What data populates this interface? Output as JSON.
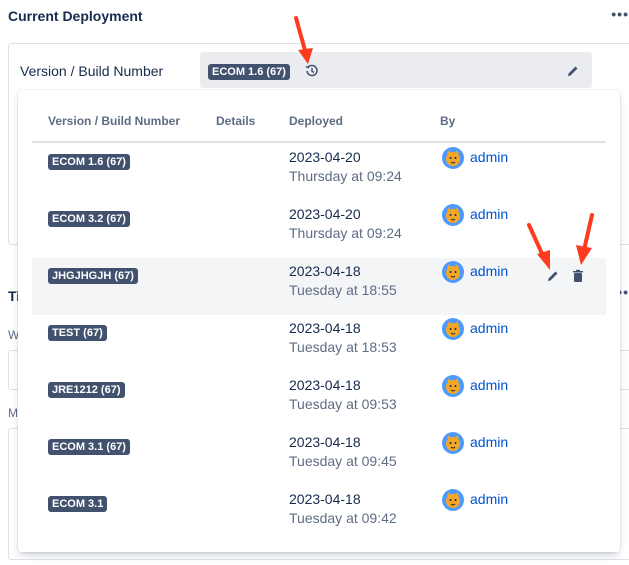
{
  "section": {
    "title": "Current Deployment",
    "more_label": "•••",
    "field_label": "Version / Build Number",
    "current_version": "ECOM 1.6 (67)"
  },
  "background": {
    "frag1": "Ti",
    "frag2": "W",
    "frag3": "M"
  },
  "history": {
    "columns": {
      "version": "Version / Build Number",
      "details": "Details",
      "deployed": "Deployed",
      "by": "By"
    },
    "rows": [
      {
        "version": "ECOM 1.6 (67)",
        "date": "2023-04-20",
        "time": "Thursday at 09:24",
        "user": "admin"
      },
      {
        "version": "ECOM 3.2 (67)",
        "date": "2023-04-20",
        "time": "Thursday at 09:24",
        "user": "admin"
      },
      {
        "version": "JHGJHGJH (67)",
        "date": "2023-04-18",
        "time": "Tuesday at 18:55",
        "user": "admin"
      },
      {
        "version": "TEST (67)",
        "date": "2023-04-18",
        "time": "Tuesday at 18:53",
        "user": "admin"
      },
      {
        "version": "JRE1212 (67)",
        "date": "2023-04-18",
        "time": "Tuesday at 09:53",
        "user": "admin"
      },
      {
        "version": "ECOM 3.1 (67)",
        "date": "2023-04-18",
        "time": "Tuesday at 09:45",
        "user": "admin"
      },
      {
        "version": "ECOM 3.1",
        "date": "2023-04-18",
        "time": "Tuesday at 09:42",
        "user": "admin"
      }
    ]
  },
  "colors": {
    "lozenge": "#42526e",
    "link": "#0052cc",
    "annotation_arrow": "#ff3b1f",
    "row_highlight": "#f4f5f7"
  },
  "icons": [
    "history-icon",
    "pencil-icon",
    "trash-icon",
    "avatar-icon",
    "annotation-arrow"
  ]
}
